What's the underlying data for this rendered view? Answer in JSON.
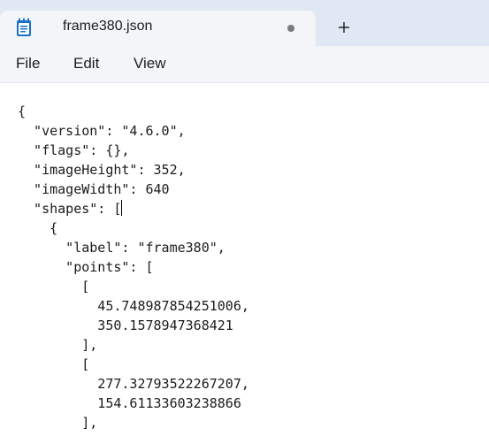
{
  "window": {
    "tab_title": "frame380.json",
    "new_tab_symbol": "+"
  },
  "menu": {
    "file": "File",
    "edit": "Edit",
    "view": "View"
  },
  "editor": {
    "lines": [
      "{",
      "  \"version\": \"4.6.0\",",
      "  \"flags\": {},",
      "  \"imageHeight\": 352,",
      "  \"imageWidth\": 640",
      "  \"shapes\": [",
      "    {",
      "      \"label\": \"frame380\",",
      "      \"points\": [",
      "        [",
      "          45.748987854251006,",
      "          350.1578947368421",
      "        ],",
      "        [",
      "          277.32793522267207,",
      "          154.61133603238866",
      "        ],"
    ],
    "caret_line": 5
  },
  "colors": {
    "titlebar_bg": "#dfe8f3",
    "tab_bg": "#f3f5f8",
    "editor_bg": "#ffffff",
    "icon_blue": "#1a73c9"
  },
  "icons": {
    "app": "notepad-icon",
    "modified": "unsaved-dot-icon",
    "new_tab": "plus-icon"
  }
}
